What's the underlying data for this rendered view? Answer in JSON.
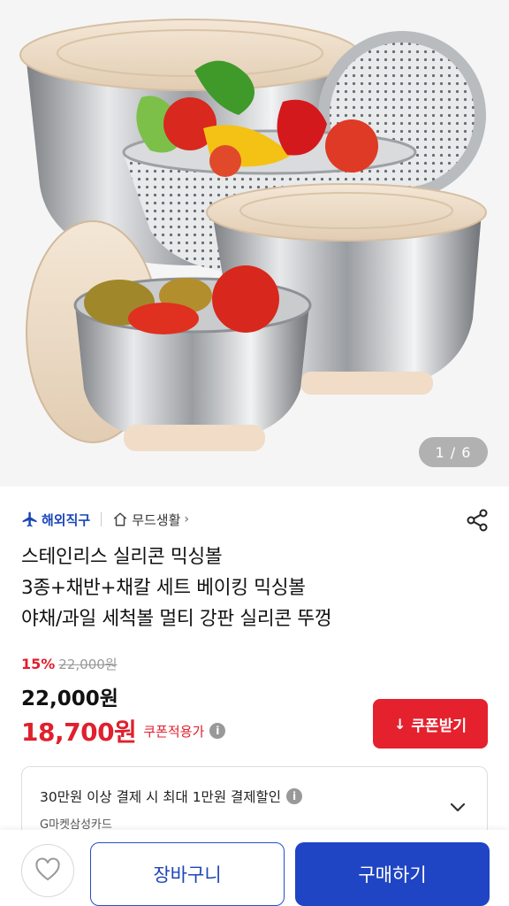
{
  "gallery": {
    "page_indicator": "1 / 6",
    "image_subject": "stainless-steel-mixing-bowls-with-lids-colander-grater"
  },
  "meta": {
    "overseas_badge": "해외직구",
    "shop_name": "무드생활",
    "shop_chevron": "›",
    "share_icon": "share-icon",
    "plane_icon": "airplane-icon",
    "home_icon": "home-icon"
  },
  "product": {
    "title_lines": [
      "스테인리스 실리콘 믹싱볼",
      "3종+채반+채칼 세트 베이킹 믹싱볼",
      "야채/과일 세척볼 멀티 강판 실리콘 뚜껑"
    ]
  },
  "price": {
    "discount_rate": "15%",
    "original_price": "22,000원",
    "sale_price": "22,000원",
    "coupon_price": "18,700원",
    "coupon_applied_label": "쿠폰적용가",
    "info_icon": "i"
  },
  "coupon_button": {
    "icon": "↓",
    "label": "쿠폰받기"
  },
  "card_promo": {
    "text": "30만원 이상 결제 시 최대 1만원 결제할인",
    "card_name": "G마켓삼성카드",
    "info_icon": "i"
  },
  "bottom_bar": {
    "wish_icon": "heart-icon",
    "cart_label": "장바구니",
    "buy_label": "구매하기"
  },
  "colors": {
    "accent_red": "#e5212e",
    "brand_blue": "#1f45c4",
    "overseas_blue": "#1a47b8"
  }
}
